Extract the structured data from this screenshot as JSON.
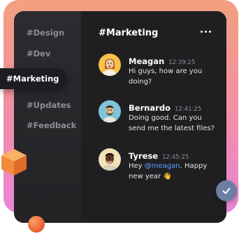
{
  "sidebar": {
    "channels": [
      "#Design",
      "#Dev",
      "#Marketing",
      "#Updates",
      "#Feedback"
    ],
    "active": "#Marketing"
  },
  "header": {
    "title": "#Marketing",
    "menu_icon": "more-horizontal-icon"
  },
  "messages": [
    {
      "name": "Meagan",
      "time": "12:39:25",
      "text": "Hi guys, how are you doing?",
      "avatar": "avatar-meagan"
    },
    {
      "name": "Bernardo",
      "time": "12:41:25",
      "text": "Doing good. Can you send me the latest files?",
      "avatar": "avatar-bernardo"
    },
    {
      "name": "Tyrese",
      "time": "12:45:25",
      "text_before": "Hey ",
      "mention": "@meagan",
      "text_after": ". Happy new year ",
      "emoji": "👋",
      "avatar": "avatar-tyrese"
    }
  ],
  "colors": {
    "backdrop_top": "#f3a07e",
    "backdrop_bottom": "#ea86d8",
    "window": "#1f1f22",
    "sidebar": "#2c2c30",
    "mention": "#5ea0ff",
    "check_badge": "#6d7ea3"
  }
}
